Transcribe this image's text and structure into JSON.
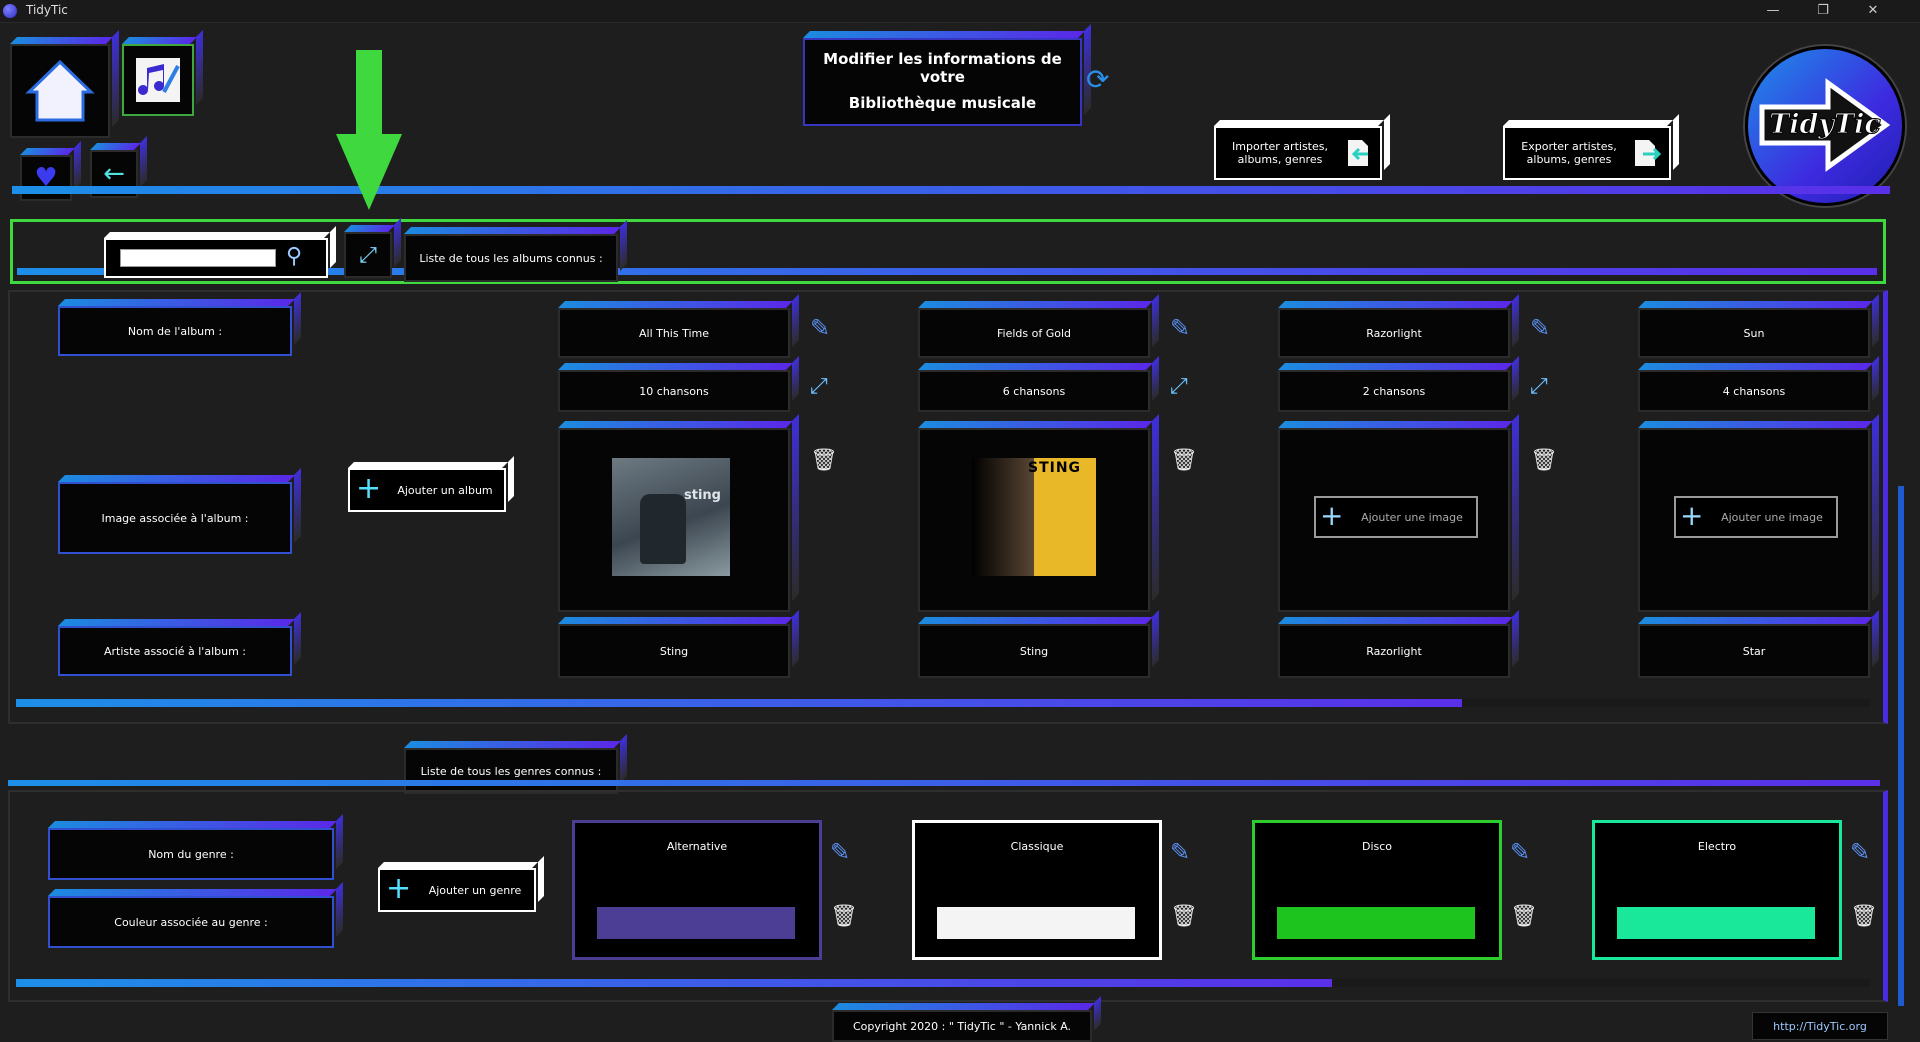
{
  "window": {
    "title": "TidyTic"
  },
  "header": {
    "title_line1": "Modifier les informations de votre",
    "title_line2": "Bibliothèque musicale",
    "import_label": "Importer artistes, albums, genres",
    "export_label": "Exporter artistes, albums, genres",
    "logo_text": "TidyTic"
  },
  "albums_section": {
    "tab_label": "Liste de tous les albums connus :",
    "search_placeholder": "",
    "label_name": "Nom de l'album :",
    "label_image": "Image associée à l'album :",
    "label_artist": "Artiste associé à l'album :",
    "add_album": "Ajouter un album",
    "add_image": "Ajouter une image",
    "scroll_fraction": 0.78,
    "albums": [
      {
        "name": "All This Time",
        "songs": "10 chansons",
        "artist": "Sting",
        "has_image": true,
        "cover_text": "sting"
      },
      {
        "name": "Fields of Gold",
        "songs": "6 chansons",
        "artist": "Sting",
        "has_image": true,
        "cover_text": "STING"
      },
      {
        "name": "Razorlight",
        "songs": "2 chansons",
        "artist": "Razorlight",
        "has_image": false
      },
      {
        "name": "Sun",
        "songs": "4 chansons",
        "artist": "Star",
        "has_image": false
      }
    ]
  },
  "genres_section": {
    "tab_label": "Liste de tous les genres connus :",
    "label_name": "Nom du genre :",
    "label_color": "Couleur associée au genre :",
    "add_genre": "Ajouter un genre",
    "scroll_fraction": 0.71,
    "genres": [
      {
        "name": "Alternative",
        "color": "#4b3e94"
      },
      {
        "name": "Classique",
        "color": "#f4f4f4"
      },
      {
        "name": "Disco",
        "color": "#1ec41e"
      },
      {
        "name": "Electro",
        "color": "#19e89a"
      }
    ]
  },
  "footer": {
    "copyright": "Copyright 2020 : \" TidyTic \" - Yannick A.",
    "link": "http://TidyTic.org"
  },
  "colors": {
    "accent_blue": "#1d8fe8",
    "accent_purple": "#5a2fe8",
    "highlight_green": "#3fd83f"
  }
}
